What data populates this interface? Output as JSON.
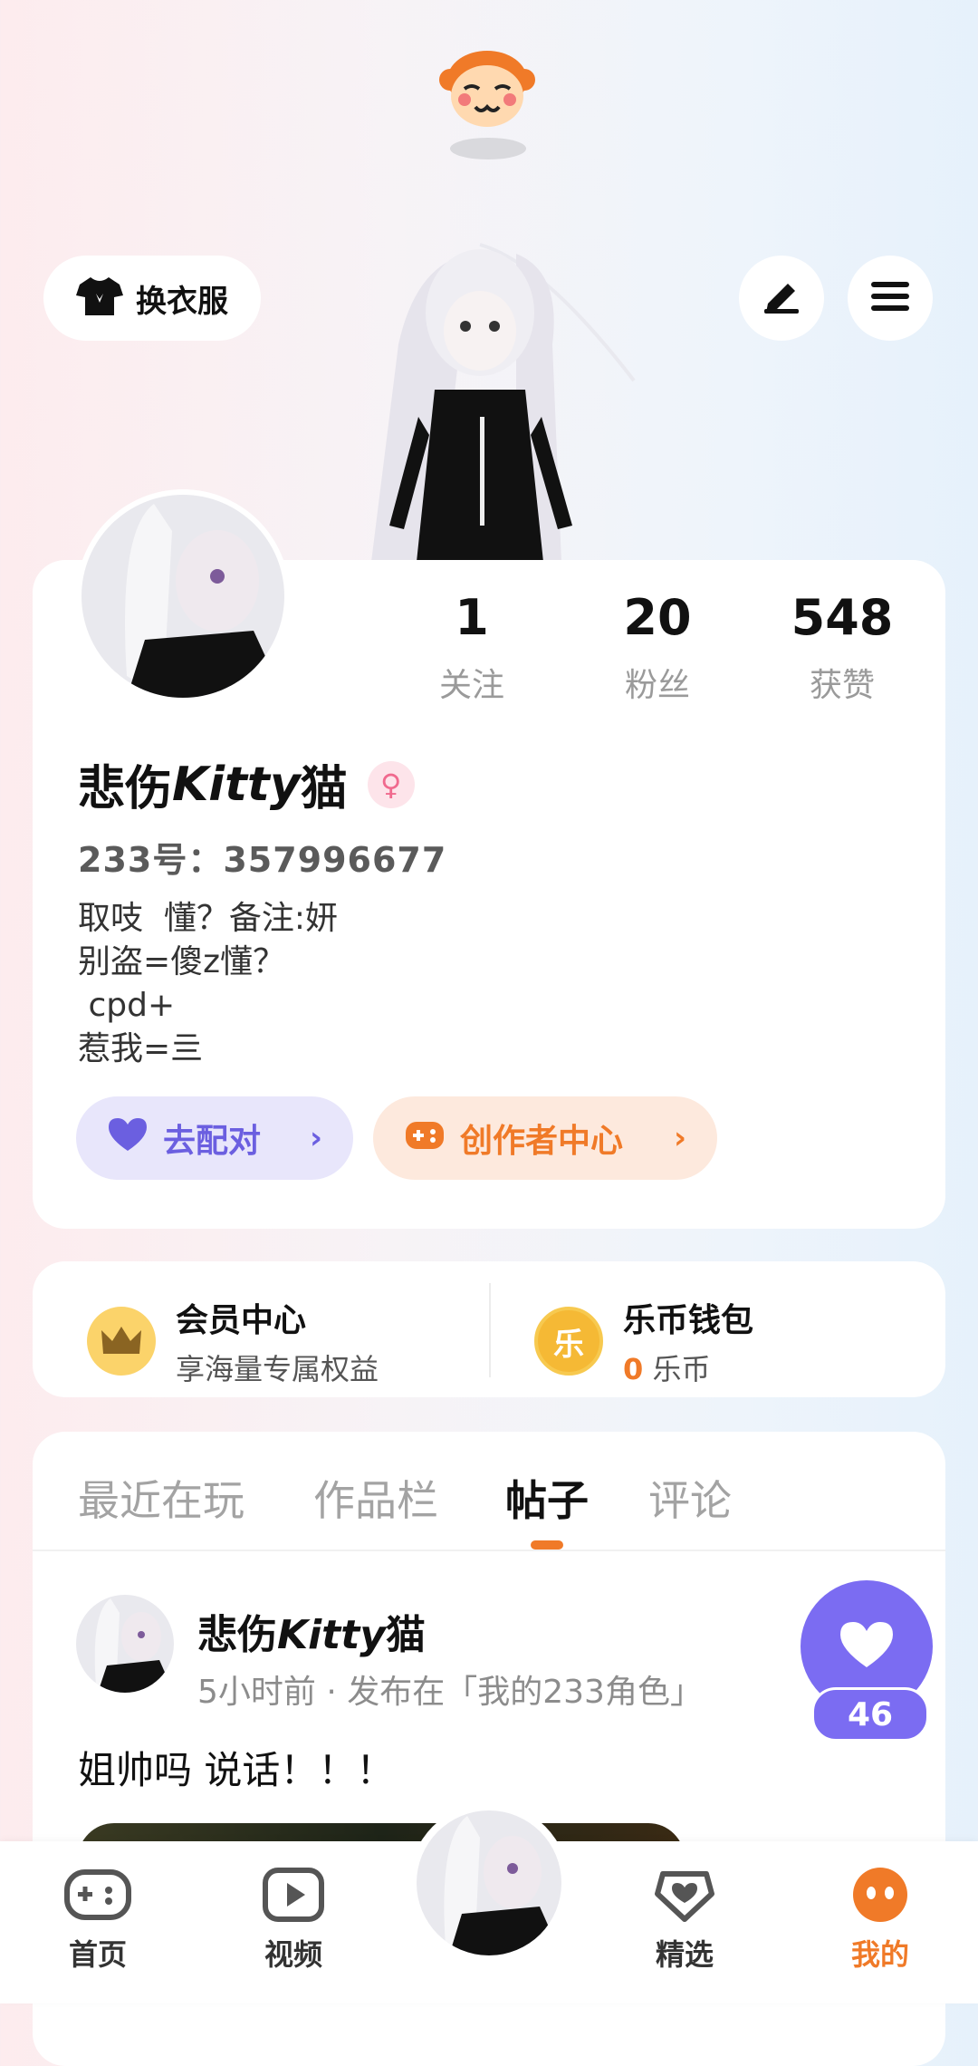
{
  "header": {
    "outfit_label": "换衣服",
    "icons": {
      "mascot": "monkey-mascot-icon",
      "outfit": "tshirt-icon",
      "edit": "pen-icon",
      "menu": "menu-icon"
    }
  },
  "profile": {
    "stats": [
      {
        "value": "1",
        "label": "关注"
      },
      {
        "value": "20",
        "label": "粉丝"
      },
      {
        "value": "548",
        "label": "获赞"
      }
    ],
    "name_prefix": "悲伤",
    "name_italic": "Kitty",
    "name_suffix": "猫",
    "gender_symbol": "♀",
    "id_line": "233号：357996677",
    "bio": "取吱  懂？备注:妍\n别盗=傻z懂？\n cpd+\n惹我=亖",
    "match_button": "去配对",
    "creator_button": "创作者中心"
  },
  "member": {
    "vip_title": "会员中心",
    "vip_sub": "享海量专属权益",
    "wallet_title": "乐币钱包",
    "wallet_amount": "0",
    "wallet_unit": "乐币",
    "coin_glyph": "乐"
  },
  "tabs": [
    {
      "label": "最近在玩"
    },
    {
      "label": "作品栏"
    },
    {
      "label": "帖子"
    },
    {
      "label": "评论"
    }
  ],
  "active_tab": "帖子",
  "post": {
    "author_prefix": "悲伤",
    "author_italic": "Kitty",
    "author_suffix": "猫",
    "meta": "5小时前 · 发布在「我的233角色」",
    "text": "姐帅吗  说话！！！",
    "likes": "46"
  },
  "nav": [
    {
      "label": "首页"
    },
    {
      "label": "视频"
    },
    {
      "label": "精选"
    },
    {
      "label": "我的"
    }
  ],
  "colors": {
    "accent_orange": "#f07a28",
    "accent_purple": "#7b6cf2",
    "gold": "#f5b935"
  }
}
